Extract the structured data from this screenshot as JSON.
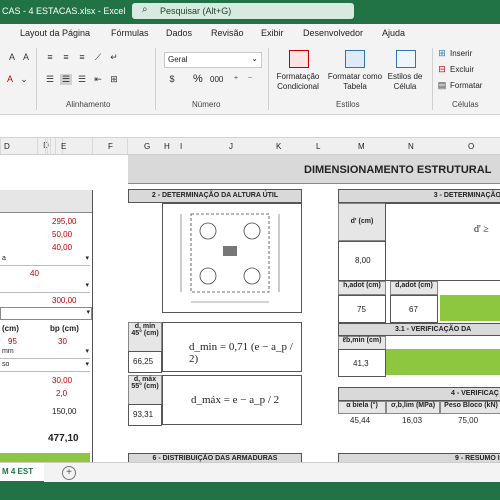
{
  "title_bar": {
    "title": "CAS - 4 ESTACAS.xlsx  -  Excel",
    "search_placeholder": "Pesquisar (Alt+G)"
  },
  "tabs": [
    "Layout da Página",
    "Fórmulas",
    "Dados",
    "Revisão",
    "Exibir",
    "Desenvolvedor",
    "Ajuda"
  ],
  "ribbon": {
    "number_format": "Geral",
    "percent": "%",
    "thousands": "000",
    "conditional_format": "Formatação Condicional",
    "format_table": "Formatar como Tabela",
    "cell_styles": "Estilos de Célula",
    "insert": "Inserir",
    "delete": "Excluir",
    "format": "Formatar",
    "groups": {
      "alignment": "Alinhamento",
      "number": "Número",
      "styles": "Estilos",
      "cells": "Células"
    }
  },
  "columns": [
    "D",
    "E",
    "F",
    "G",
    "H",
    "I",
    "J",
    "K",
    "L",
    "M",
    "N",
    "O"
  ],
  "sheet": {
    "main_title": "DIMENSIONAMENTO ESTRUTURAL",
    "left_values": [
      "295,00",
      "50,00",
      "40,00",
      "40",
      "300,00"
    ],
    "left_sel_a": "a",
    "left_sel_b": "mm",
    "left_sel_c": "so",
    "left_headers": [
      "(cm)",
      "bp (cm)"
    ],
    "left_pair": [
      "95",
      "30"
    ],
    "left_values2": [
      "30,00",
      "2,0",
      "150,00"
    ],
    "left_total": "477,10",
    "section2_title": "2 - DETERMINAÇÃO DA ALTURA ÚTIL",
    "dmin_label": "d, mín 45° (cm)",
    "dmin_value": "66,25",
    "dmin_formula": "d_min = 0,71 (e − a_p / 2)",
    "dmax_label": "d, máx 55° (cm)",
    "dmax_value": "93,31",
    "dmax_formula": "d_máx = e − a_p / 2",
    "section3_title": "3 - DETERMINAÇÃO DA",
    "dprime_label": "d' (cm)",
    "dprime_value": "8,00",
    "dprime_formula": "d' ≥",
    "hadot_label": "h,adot (cm)",
    "dadot_label": "d,adot (cm)",
    "hadot_value": "75",
    "dadot_value": "67",
    "section31_title": "3.1 - VERIFICAÇÃO DA",
    "fib_label": "ℓb,min (cm)",
    "fib_value": "41,3",
    "section4_title": "4 - VERIFICAÇ",
    "alpha_label": "α biela (°)",
    "sigma_label": "σ,b,lim (MPa)",
    "peso_label": "Peso Bloco (kN)",
    "alpha_value": "45,44",
    "sigma_value": "16,03",
    "peso_value": "75,00",
    "section6_title": "6 - DISTRIBUIÇÃO DAS ARMADURAS",
    "section9_title": "9 - RESUMO I"
  },
  "sheet_tab": "M 4 EST",
  "colors": {
    "excel_green": "#217346",
    "highlight_green": "#8dc63f",
    "header_gray": "#d9d9d9"
  }
}
